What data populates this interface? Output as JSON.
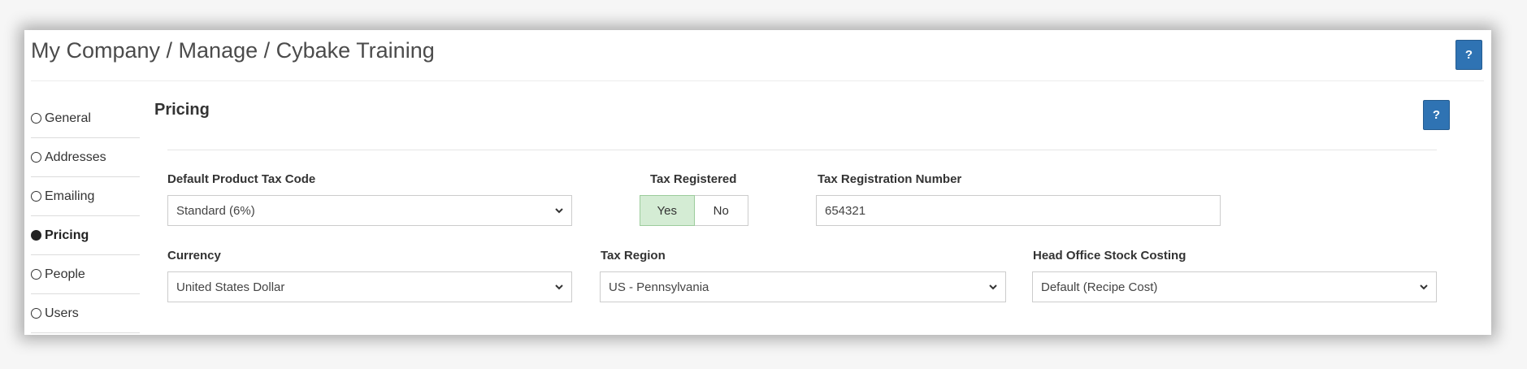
{
  "breadcrumb": "My Company / Manage / Cybake Training",
  "help_label": "?",
  "sidebar": {
    "items": [
      {
        "label": "General",
        "active": false
      },
      {
        "label": "Addresses",
        "active": false
      },
      {
        "label": "Emailing",
        "active": false
      },
      {
        "label": "Pricing",
        "active": true
      },
      {
        "label": "People",
        "active": false
      },
      {
        "label": "Users",
        "active": false
      }
    ]
  },
  "section": {
    "title": "Pricing"
  },
  "fields": {
    "default_product_tax_code": {
      "label": "Default Product Tax Code",
      "value": "Standard (6%)"
    },
    "tax_registered": {
      "label": "Tax Registered",
      "yes_label": "Yes",
      "no_label": "No",
      "selected": "Yes"
    },
    "tax_registration_number": {
      "label": "Tax Registration Number",
      "value": "654321"
    },
    "currency": {
      "label": "Currency",
      "value": "United States Dollar"
    },
    "tax_region": {
      "label": "Tax Region",
      "value": "US - Pennsylvania"
    },
    "head_office_stock_costing": {
      "label": "Head Office Stock Costing",
      "value": "Default (Recipe Cost)"
    }
  },
  "colors": {
    "accent": "#2f73b3",
    "toggle_selected": "#d4ecd4"
  },
  "icons": {
    "help": "question-mark-icon",
    "dropdown": "chevron-down-icon",
    "radio_off": "radio-unchecked-icon",
    "radio_on": "radio-checked-icon"
  }
}
